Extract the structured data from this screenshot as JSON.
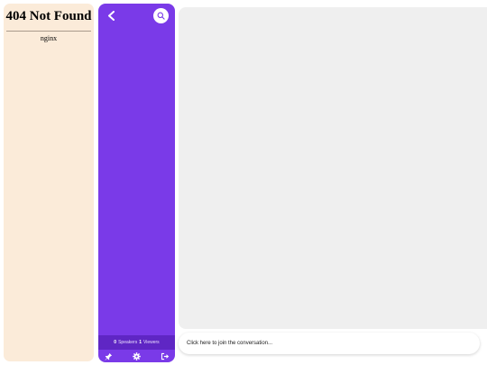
{
  "error_page": {
    "title": "404 Not Found",
    "server": "nginx"
  },
  "room": {
    "back_icon": "chevron-left-icon",
    "search_icon": "search-icon",
    "speakers_count": "0",
    "speakers_label": "Speakers",
    "viewers_count": "1",
    "viewers_label": "Viewers",
    "toolbar": {
      "pin_icon": "pin-icon",
      "settings_icon": "gear-icon",
      "exit_icon": "exit-icon"
    },
    "accent_color": "#7a3ae8",
    "stats_bar_color": "#5f26c4"
  },
  "chat": {
    "join_prompt": "Click here to join the conversation..."
  }
}
